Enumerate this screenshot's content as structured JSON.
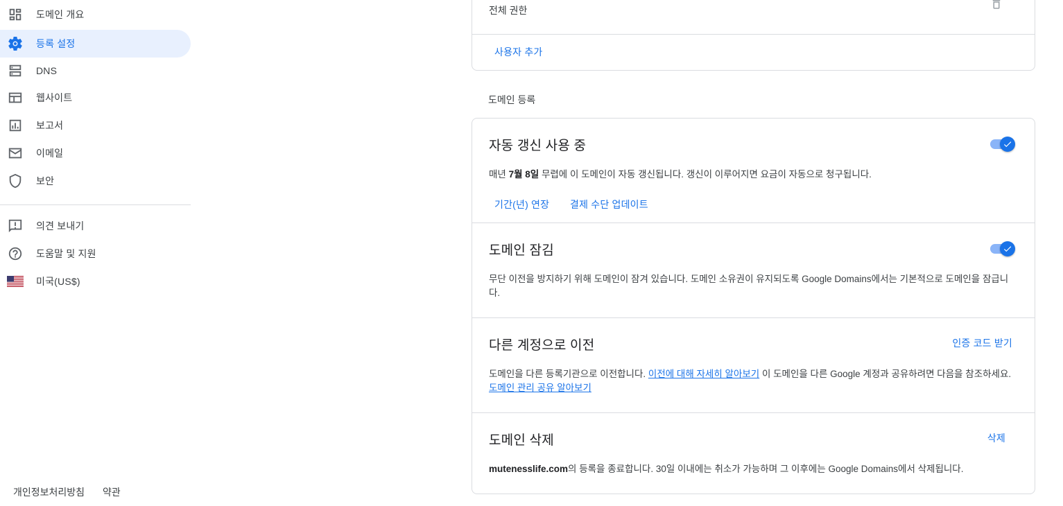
{
  "sidebar": {
    "items": [
      {
        "label": "도메인 개요",
        "icon": "dashboard-icon"
      },
      {
        "label": "등록 설정",
        "icon": "gear-icon",
        "active": true
      },
      {
        "label": "DNS",
        "icon": "dns-icon"
      },
      {
        "label": "웹사이트",
        "icon": "website-icon"
      },
      {
        "label": "보고서",
        "icon": "bar-chart-icon"
      },
      {
        "label": "이메일",
        "icon": "mail-icon"
      },
      {
        "label": "보안",
        "icon": "shield-icon"
      }
    ],
    "secondary_items": [
      {
        "label": "의견 보내기",
        "icon": "feedback-icon"
      },
      {
        "label": "도움말 및 지원",
        "icon": "help-icon"
      },
      {
        "label": "미국(US$)",
        "icon": "us-flag-icon"
      }
    ],
    "footer": {
      "privacy": "개인정보처리방침",
      "terms": "약관"
    }
  },
  "permissions_card": {
    "permission_text": "전체 권한",
    "add_user": "사용자 추가"
  },
  "registration": {
    "heading": "도메인 등록",
    "auto_renew": {
      "title": "자동 갱신 사용 중",
      "body_prefix": "매년 ",
      "date": "7월 8일",
      "body_suffix": " 무렵에 이 도메인이 자동 갱신됩니다. 갱신이 이루어지면 요금이 자동으로 청구됩니다.",
      "extend_link": "기간(년) 연장",
      "payment_link": "결제 수단 업데이트",
      "enabled": true
    },
    "domain_lock": {
      "title": "도메인 잠김",
      "body": "무단 이전을 방지하기 위해 도메인이 잠겨 있습니다. 도메인 소유권이 유지되도록 Google Domains에서는 기본적으로 도메인을 잠급니다.",
      "enabled": true
    },
    "transfer": {
      "title": "다른 계정으로 이전",
      "action": "인증 코드 받기",
      "body_1": "도메인을 다른 등록기관으로 이전합니다. ",
      "link_1": "이전에 대해 자세히 알아보기",
      "body_2": " 이 도메인을 다른 Google 계정과 공유하려면 다음을 참조하세요. ",
      "link_2": "도메인 관리 공유 알아보기"
    },
    "delete": {
      "title": "도메인 삭제",
      "action": "삭제",
      "domain": "mutenesslife.com",
      "body_suffix": "의 등록을 종료합니다. 30일 이내에는 취소가 가능하며 그 이후에는 Google Domains에서 삭제됩니다."
    }
  },
  "colors": {
    "accent": "#1a73e8",
    "active_bg": "#e8f0fe",
    "border": "#dadce0"
  }
}
